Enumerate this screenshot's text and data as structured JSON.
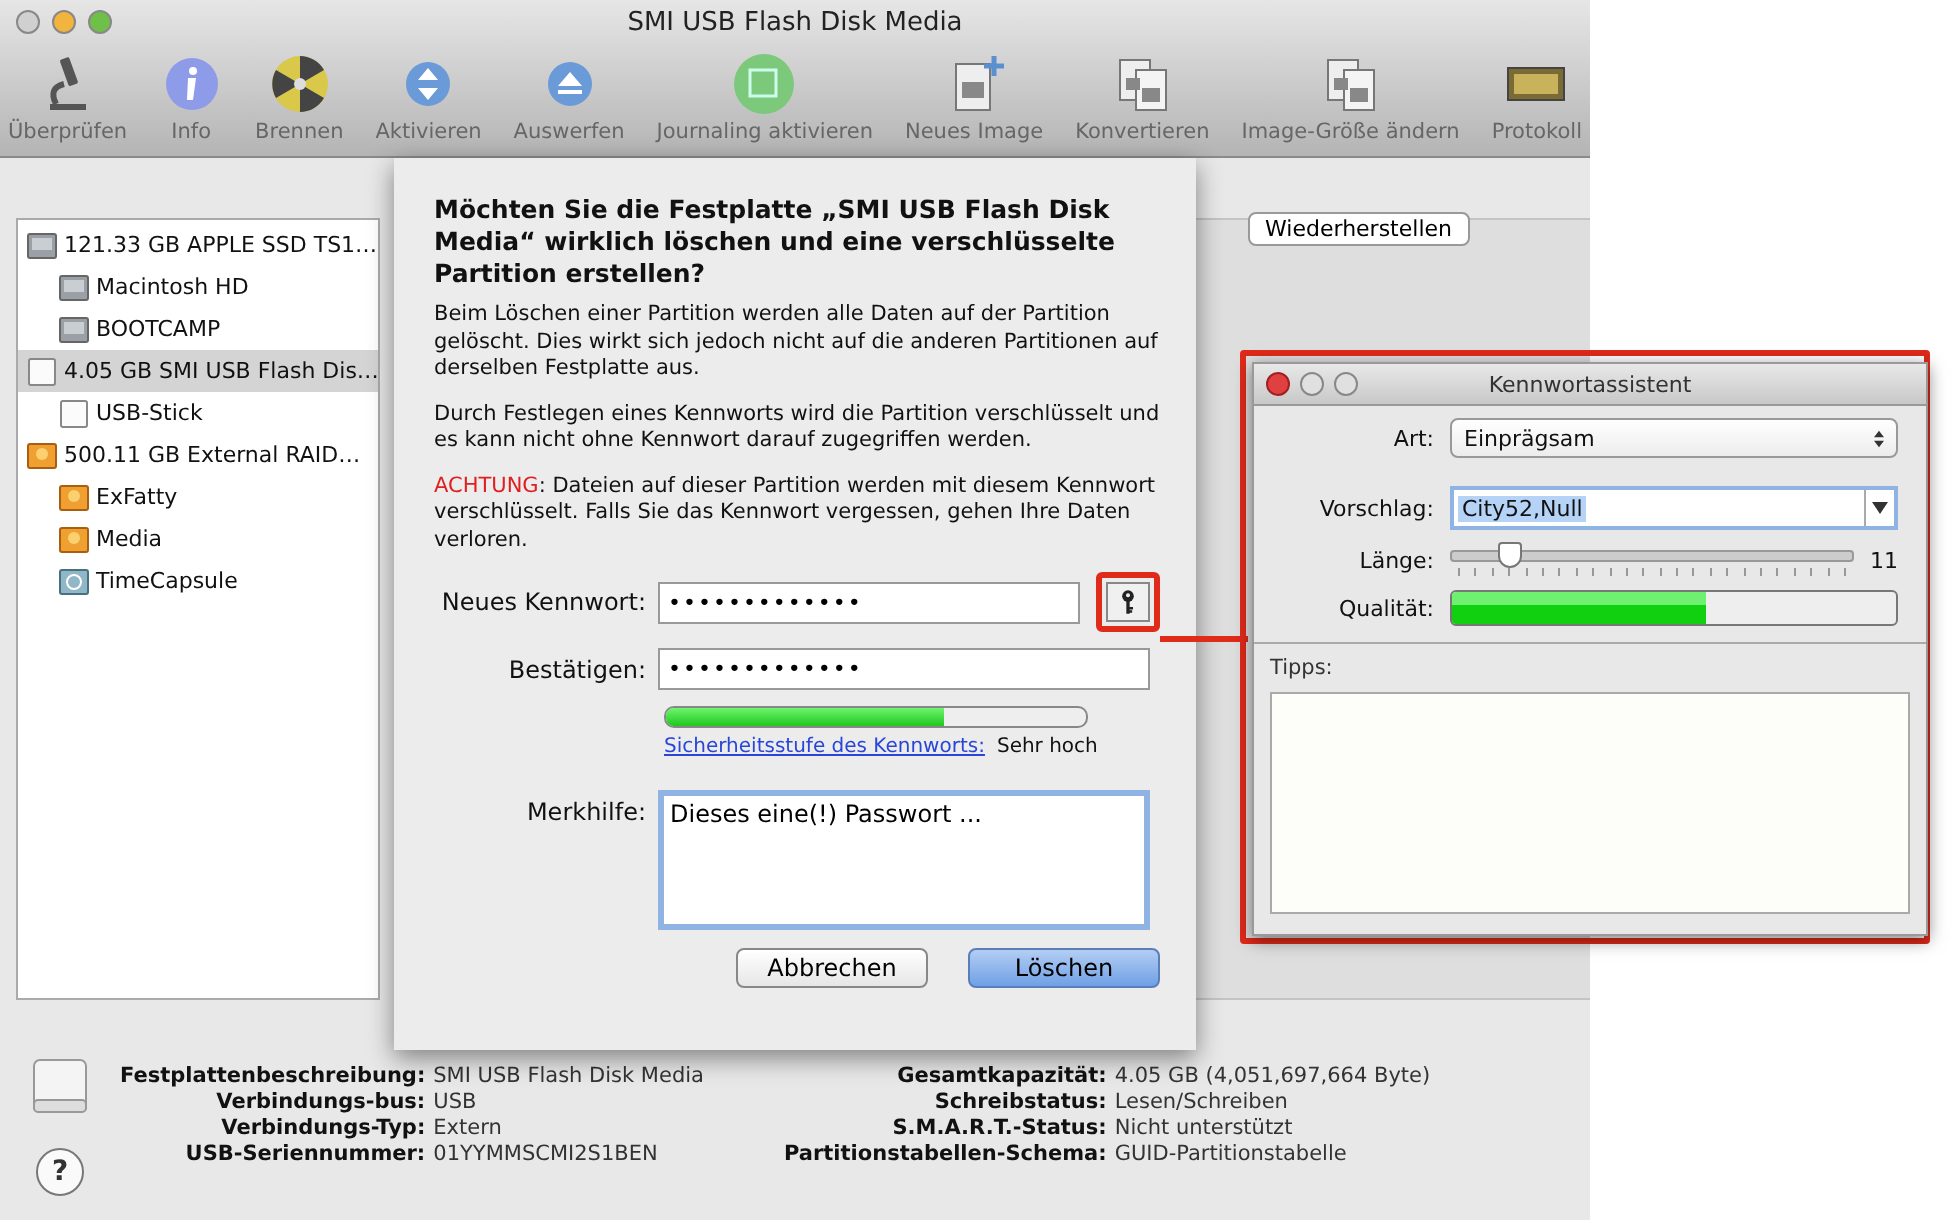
{
  "window": {
    "title": "SMI USB Flash Disk Media"
  },
  "toolbar": [
    {
      "label": "Überprüfen",
      "kind": "microscope"
    },
    {
      "label": "Info",
      "kind": "info"
    },
    {
      "label": "Brennen",
      "kind": "burn"
    },
    {
      "label": "Aktivieren",
      "kind": "mount"
    },
    {
      "label": "Auswerfen",
      "kind": "eject"
    },
    {
      "label": "Journaling aktivieren",
      "kind": "journal"
    },
    {
      "label": "Neues Image",
      "kind": "newimage"
    },
    {
      "label": "Konvertieren",
      "kind": "convert"
    },
    {
      "label": "Image-Größe ändern",
      "kind": "resize"
    },
    {
      "label": "Protokoll",
      "kind": "log"
    }
  ],
  "sidebar": {
    "items": [
      {
        "label": "121.33 GB APPLE SSD TS1…",
        "kind": "internal",
        "selected": false,
        "children": [
          {
            "label": "Macintosh HD",
            "kind": "internal",
            "selected": false
          },
          {
            "label": "BOOTCAMP",
            "kind": "internal",
            "selected": false
          }
        ]
      },
      {
        "label": "4.05 GB SMI USB Flash Dis…",
        "kind": "usb",
        "selected": true,
        "children": [
          {
            "label": "USB-Stick",
            "kind": "usb",
            "selected": false
          }
        ]
      },
      {
        "label": "500.11 GB External RAID…",
        "kind": "external",
        "selected": false,
        "children": [
          {
            "label": "ExFatty",
            "kind": "external",
            "selected": false
          },
          {
            "label": "Media",
            "kind": "external",
            "selected": false
          },
          {
            "label": "TimeCapsule",
            "kind": "timecapsule",
            "selected": false
          }
        ]
      }
    ]
  },
  "panel": {
    "restore_button": "Wiederherstellen",
    "help_button": "?"
  },
  "dialog": {
    "title": "Möchten Sie die Festplatte „SMI USB Flash Disk Media“ wirklich löschen und eine verschlüsselte Partition erstellen?",
    "paragraphs": [
      "Beim Löschen einer Partition werden alle Daten auf der Partition gelöscht. Dies wirkt sich jedoch nicht auf die anderen Partitionen auf derselben Festplatte aus.",
      "Durch Festlegen eines Kennworts wird die Partition verschlüsselt und es kann nicht ohne Kennwort darauf zugegriffen werden."
    ],
    "warning": {
      "highlight": "ACHTUNG",
      "text": ": Dateien auf dieser Partition werden mit diesem Kennwort verschlüsselt. Falls Sie das Kennwort vergessen, gehen Ihre Daten verloren."
    },
    "new_password": {
      "label": "Neues Kennwort:",
      "value": "•••••••••••••"
    },
    "confirm": {
      "label": "Bestätigen:",
      "value": "•••••••••••••"
    },
    "strength": {
      "level": 0.66,
      "link": "Sicherheitsstufe des Kennworts:",
      "value": "Sehr hoch"
    },
    "hint": {
      "label": "Merkhilfe:",
      "value": "Dieses eine(!) Passwort ..."
    },
    "buttons": [
      {
        "label": "Abbrechen",
        "default": false
      },
      {
        "label": "Löschen",
        "default": true
      }
    ]
  },
  "assistant": {
    "title": "Kennwortassistent",
    "type": {
      "label": "Art:",
      "value": "Einprägsam"
    },
    "suggestion": {
      "label": "Vorschlag:",
      "value": "City52,Null"
    },
    "length": {
      "label": "Länge:",
      "level": 0.15,
      "reading": "11"
    },
    "quality": {
      "label": "Qualität:",
      "level": 0.57
    },
    "tips": {
      "label": "Tipps:"
    }
  },
  "info": {
    "left": [
      {
        "label": "Festplattenbeschreibung:",
        "value": "SMI USB Flash Disk Media"
      },
      {
        "label": "Verbindungs-bus:",
        "value": "USB"
      },
      {
        "label": "Verbindungs-Typ:",
        "value": "Extern"
      },
      {
        "label": "USB-Seriennummer:",
        "value": "01YYMMSCMI2S1BEN"
      }
    ],
    "right": [
      {
        "label": "Gesamtkapazität:",
        "value": "4.05 GB (4,051,697,664 Byte)"
      },
      {
        "label": "Schreibstatus:",
        "value": "Lesen/Schreiben"
      },
      {
        "label": "S.M.A.R.T.-Status:",
        "value": "Nicht unterstützt"
      },
      {
        "label": "Partitionstabellen-Schema:",
        "value": "GUID-Partitionstabelle"
      }
    ]
  }
}
